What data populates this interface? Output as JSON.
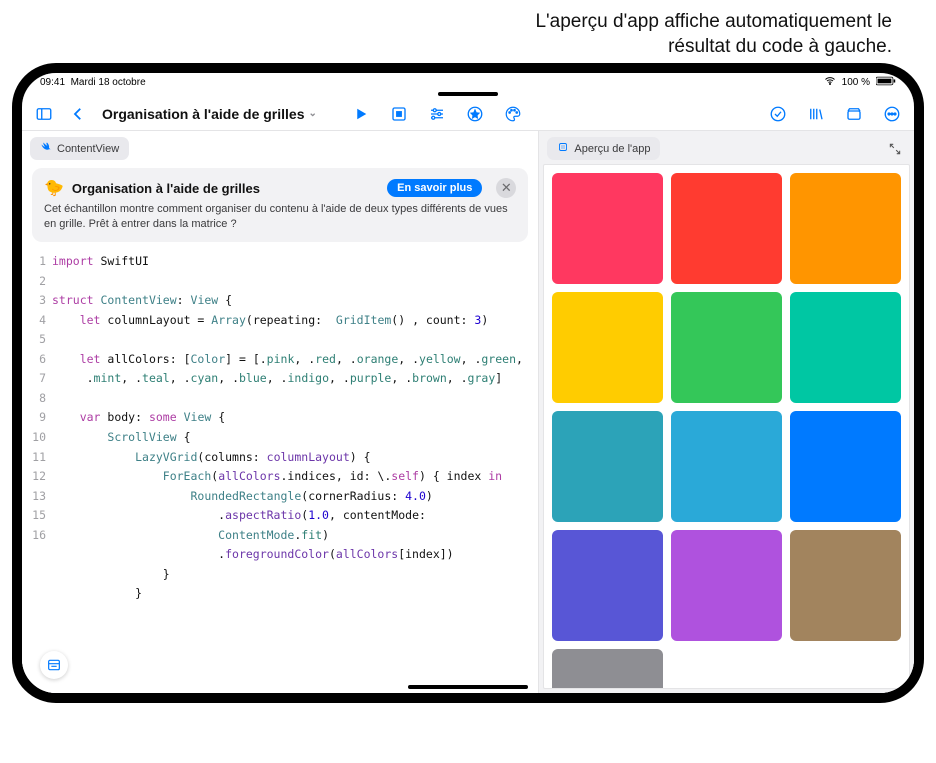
{
  "callout": {
    "line1": "L'aperçu d'app affiche automatiquement le",
    "line2": "résultat du code à gauche."
  },
  "statusbar": {
    "time": "09:41",
    "date": "Mardi 18 octobre",
    "battery": "100 %"
  },
  "toolbar": {
    "title": "Organisation à l'aide de grilles"
  },
  "tabs": {
    "file": "ContentView",
    "preview": "Aperçu de l'app"
  },
  "info": {
    "title": "Organisation à l'aide de grilles",
    "cta": "En savoir plus",
    "body": "Cet échantillon montre comment organiser du contenu à l'aide de deux types différents de vues en grille. Prêt à entrer dans la matrice ?"
  },
  "code": {
    "lines": [
      "1",
      "2",
      "3",
      "4",
      "5",
      "6",
      "",
      "7",
      "8",
      "9",
      "10",
      "11",
      "12",
      "13",
      "",
      "",
      "15",
      "16"
    ]
  },
  "preview_colors": [
    "#ff3860",
    "#ff3b30",
    "#ff9500",
    "#ffcc00",
    "#34c759",
    "#00c7a3",
    "#2ca3b8",
    "#2aa9d8",
    "#007aff",
    "#5856d6",
    "#af52de",
    "#a2845e",
    "#8e8e93"
  ]
}
